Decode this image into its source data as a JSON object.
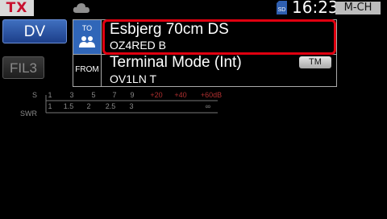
{
  "status_bar": {
    "tx_label": "TX",
    "time": "16:23",
    "sd_label": "SD",
    "memory_mode": "M-CH",
    "icons": [
      "cloud-icon",
      "sd-card-icon"
    ]
  },
  "sidebar": {
    "mode_button": "DV",
    "filter_button": "FIL3"
  },
  "to": {
    "label": "TO",
    "name": "Esbjerg 70cm DS",
    "callsign": "OZ4RED B",
    "icon": "group-icon"
  },
  "from": {
    "label": "FROM",
    "name": "Terminal Mode (Int)",
    "callsign": "OV1LN  T",
    "tm_button": "TM"
  },
  "meter": {
    "s_label": "S",
    "s_scale": [
      "1",
      "3",
      "5",
      "7",
      "9"
    ],
    "s_over": [
      "+20",
      "+40",
      "+60dB"
    ],
    "swr_label": "SWR",
    "swr_scale": [
      "1",
      "1.5",
      "2",
      "2.5",
      "3",
      "∞"
    ]
  },
  "colors": {
    "tx_text": "#c8102e",
    "to_cell": "#3066b8",
    "highlight": "#e00010",
    "meter_over": "#b03030"
  }
}
